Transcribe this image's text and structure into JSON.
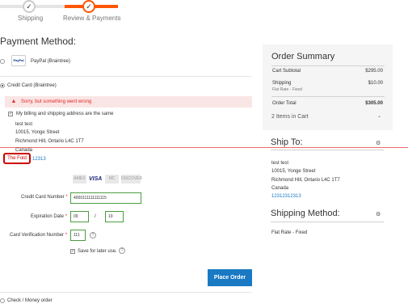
{
  "progress": {
    "steps": [
      {
        "label": "Shipping",
        "icon": "check-icon"
      },
      {
        "label": "Review & Payments",
        "icon": "check-icon"
      }
    ]
  },
  "payment": {
    "title": "Payment Method:",
    "paypal_label": "PayPal (Braintree)",
    "paypal_logo_text": "PayPal",
    "credit_card_label": "Credit Card (Braintree)",
    "error_message": "Sorry, but something went wrong",
    "same_address_label": "My billing and shipping address are the same",
    "address": {
      "name": "test test",
      "street": "10015, Yonge Street",
      "city": "Richmond Hill, Ontario L4C 1T7",
      "country": "Canada",
      "phone_partial": "12313"
    },
    "fold_label": "The Fold",
    "cards": [
      "AMEX",
      "VISA",
      "MC",
      "DISCOVER"
    ],
    "cc_number_label": "Credit Card Number",
    "cc_number_value": "4000111111111115",
    "exp_label": "Expiration Date",
    "exp_month": "09",
    "exp_sep": "/",
    "exp_year": "19",
    "cvv_label": "Card Verification Number",
    "cvv_value": "111",
    "save_label": "Save for later use.",
    "place_order_label": "Place Order",
    "check_money_label": "Check / Money order"
  },
  "summary": {
    "title": "Order Summary",
    "subtotal_label": "Cart Subtotal",
    "subtotal_value": "$295.00",
    "shipping_label": "Shipping",
    "shipping_sub": "Flat Rate - Fixed",
    "shipping_value": "$10.00",
    "total_label": "Order Total",
    "total_value": "$305.00",
    "items_in_cart": "2 Items in Cart"
  },
  "ship_to": {
    "title": "Ship To:",
    "name": "test test",
    "street": "10015, Yonge Street",
    "city": "Richmond Hill, Ontario L4C 1T7",
    "country": "Canada",
    "phone": "12312312313"
  },
  "shipping_method": {
    "title": "Shipping Method:",
    "value": "Flat Rate - Fixed"
  },
  "colors": {
    "accent": "#ff5501",
    "button": "#1979c3",
    "error": "#e02b27",
    "valid_border": "#4a9d3f"
  }
}
